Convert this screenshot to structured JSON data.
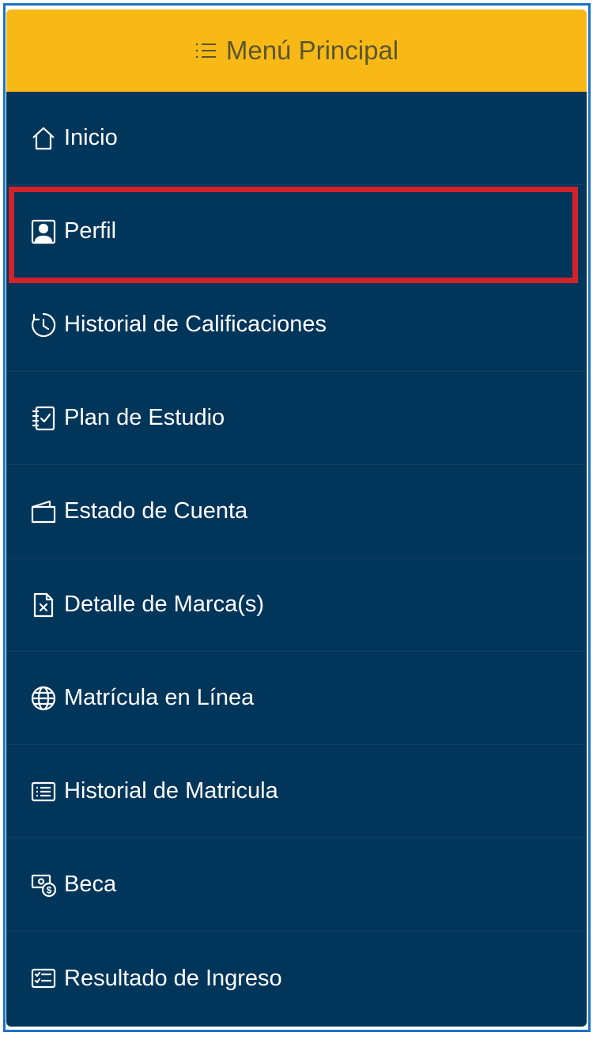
{
  "header": {
    "title": "Menú Principal",
    "icon": "list-icon",
    "bg_color": "#f8b917"
  },
  "menu": {
    "bg_color": "#02355a",
    "highlight_color": "#d4222b",
    "highlighted_item": "Perfil",
    "items": [
      {
        "label": "Inicio",
        "icon": "home-icon"
      },
      {
        "label": "Perfil",
        "icon": "profile-icon"
      },
      {
        "label": "Historial de Calificaciones",
        "icon": "clock-icon"
      },
      {
        "label": "Plan de Estudio",
        "icon": "checklist-notebook-icon"
      },
      {
        "label": "Estado de Cuenta",
        "icon": "wallet-icon"
      },
      {
        "label": "Detalle de Marca(s)",
        "icon": "document-x-icon"
      },
      {
        "label": "Matrícula en Línea",
        "icon": "globe-icon"
      },
      {
        "label": "Historial de Matricula",
        "icon": "list-card-icon"
      },
      {
        "label": "Beca",
        "icon": "cash-coin-icon"
      },
      {
        "label": "Resultado de Ingreso",
        "icon": "checklist-card-icon"
      }
    ]
  }
}
